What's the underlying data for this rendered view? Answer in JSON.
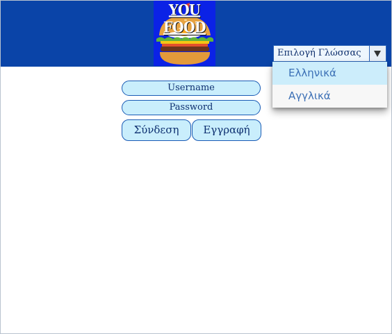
{
  "logo": {
    "text": "YOU FOOD",
    "icon": "burger-icon",
    "background_color": "#0b22e6"
  },
  "header": {
    "background_color": "#0a44a8"
  },
  "language": {
    "select_label": "Επιλογή Γλώσσας",
    "options": [
      "Ελληνικά",
      "Αγγλικά"
    ],
    "highlighted_option": "Ελληνικά"
  },
  "form": {
    "username_placeholder": "Username",
    "password_placeholder": "Password",
    "login_label": "Σύνδεση",
    "register_label": "Εγγραφή"
  },
  "colors": {
    "accent_fill": "#c9eefc",
    "accent_border": "#1a5bb5",
    "option_highlight": "#ccedfb"
  }
}
